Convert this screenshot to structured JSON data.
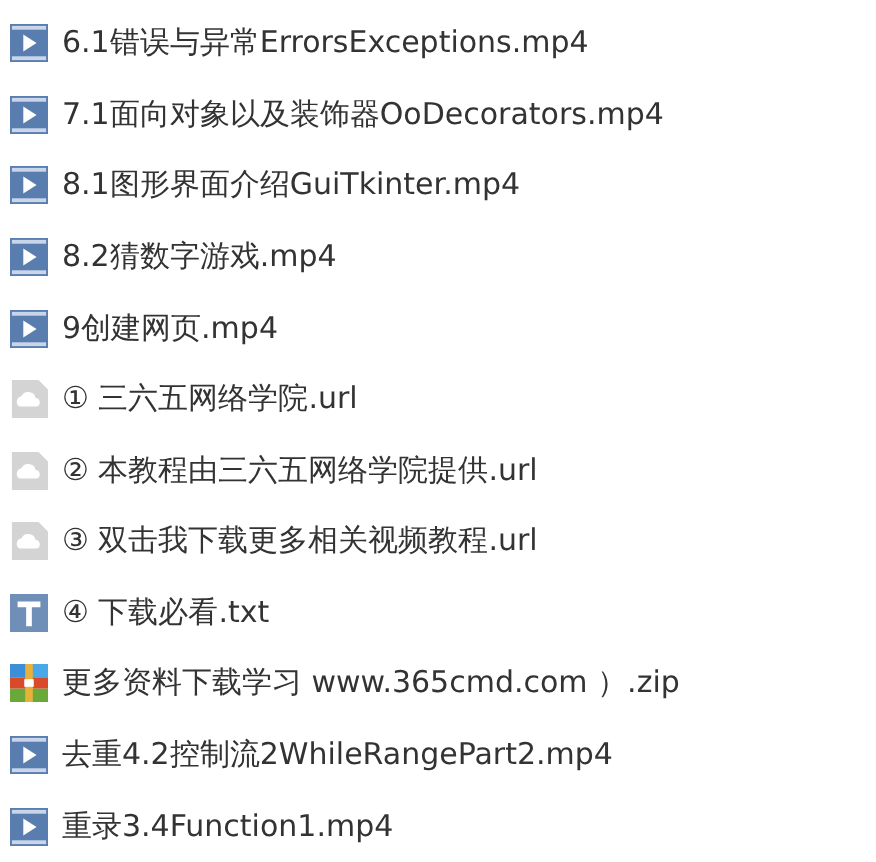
{
  "files": [
    {
      "kind": "video",
      "name": "6.1错误与异常ErrorsExceptions.mp4"
    },
    {
      "kind": "video",
      "name": "7.1面向对象以及装饰器OoDecorators.mp4"
    },
    {
      "kind": "video",
      "name": "8.1图形界面介绍GuiTkinter.mp4"
    },
    {
      "kind": "video",
      "name": "8.2猜数字游戏.mp4"
    },
    {
      "kind": "video",
      "name": "9创建网页.mp4"
    },
    {
      "kind": "url",
      "name": "① 三六五网络学院.url"
    },
    {
      "kind": "url",
      "name": "② 本教程由三六五网络学院提供.url"
    },
    {
      "kind": "url",
      "name": "③ 双击我下载更多相关视频教程.url"
    },
    {
      "kind": "text",
      "name": "④ 下载必看.txt"
    },
    {
      "kind": "archive",
      "name": "更多资料下载学习 www.365cmd.com ）.zip"
    },
    {
      "kind": "video",
      "name": "去重4.2控制流2WhileRangePart2.mp4"
    },
    {
      "kind": "video",
      "name": "重录3.4Function1.mp4"
    }
  ]
}
